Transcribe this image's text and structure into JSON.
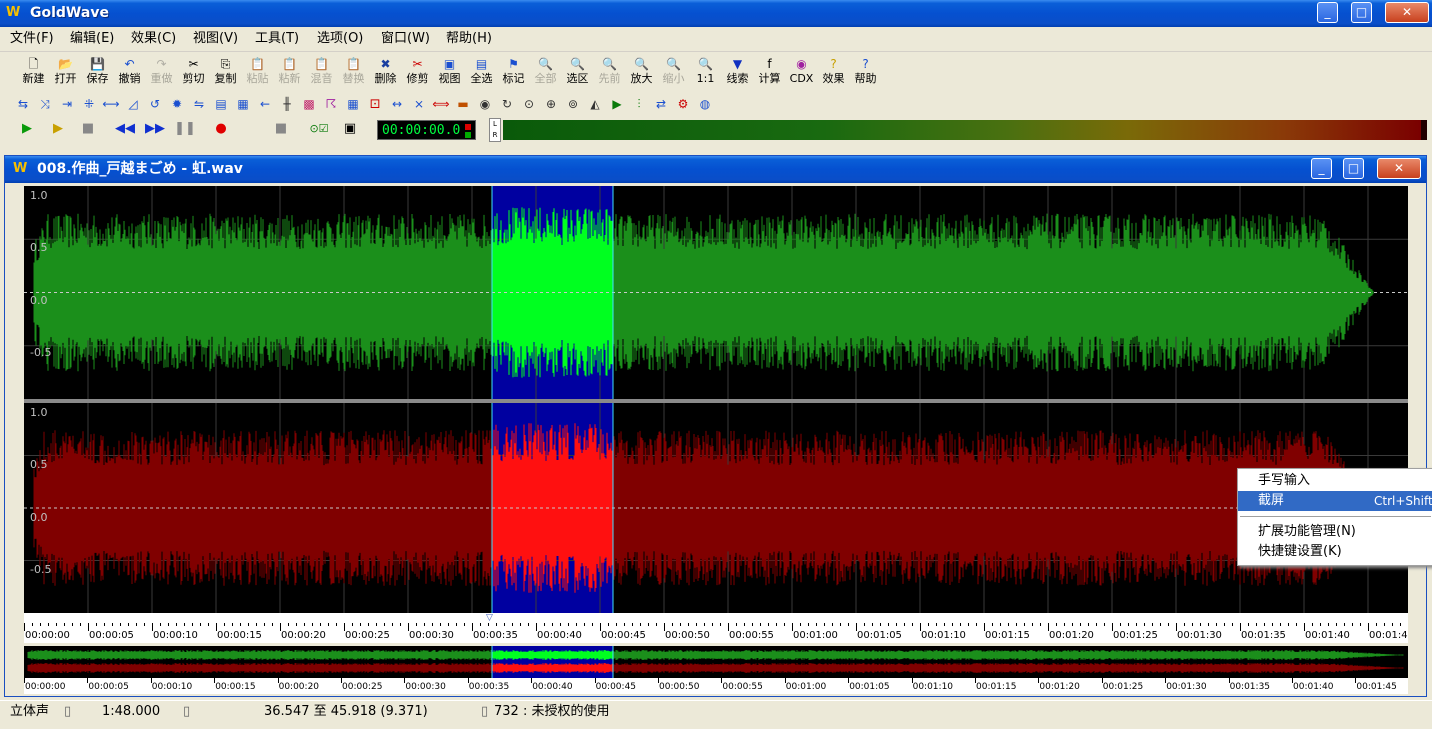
{
  "app": {
    "title": "GoldWave",
    "logo": "W",
    "window_controls": [
      "minimize-icon",
      "maximize-icon",
      "close-icon"
    ]
  },
  "menu": [
    "文件(F)",
    "编辑(E)",
    "效果(C)",
    "视图(V)",
    "工具(T)",
    "选项(O)",
    "窗口(W)",
    "帮助(H)"
  ],
  "toolbar1": [
    {
      "label": "新建",
      "icon": "new-file-icon",
      "enabled": true
    },
    {
      "label": "打开",
      "icon": "open-folder-icon",
      "enabled": true
    },
    {
      "label": "保存",
      "icon": "save-icon",
      "enabled": true
    },
    {
      "label": "撤销",
      "icon": "undo-icon",
      "enabled": true
    },
    {
      "label": "重做",
      "icon": "redo-icon",
      "enabled": false
    },
    {
      "label": "剪切",
      "icon": "cut-icon",
      "enabled": true
    },
    {
      "label": "复制",
      "icon": "copy-icon",
      "enabled": true
    },
    {
      "label": "粘贴",
      "icon": "paste-icon",
      "enabled": false
    },
    {
      "label": "粘新",
      "icon": "paste-new-icon",
      "enabled": false
    },
    {
      "label": "混音",
      "icon": "mix-icon",
      "enabled": false
    },
    {
      "label": "替换",
      "icon": "replace-icon",
      "enabled": false
    },
    {
      "label": "删除",
      "icon": "delete-icon",
      "enabled": true
    },
    {
      "label": "修剪",
      "icon": "trim-icon",
      "enabled": true
    },
    {
      "label": "视图",
      "icon": "view-icon",
      "enabled": true
    },
    {
      "label": "全选",
      "icon": "select-all-icon",
      "enabled": true
    },
    {
      "label": "标记",
      "icon": "marker-icon",
      "enabled": true
    },
    {
      "label": "全部",
      "icon": "zoom-all-icon",
      "enabled": false
    },
    {
      "label": "选区",
      "icon": "zoom-selection-icon",
      "enabled": true
    },
    {
      "label": "先前",
      "icon": "zoom-previous-icon",
      "enabled": false
    },
    {
      "label": "放大",
      "icon": "zoom-in-icon",
      "enabled": true
    },
    {
      "label": "缩小",
      "icon": "zoom-out-icon",
      "enabled": false
    },
    {
      "label": "1:1",
      "icon": "zoom-1-1-icon",
      "enabled": true
    },
    {
      "label": "线索",
      "icon": "cue-icon",
      "enabled": true
    },
    {
      "label": "计算",
      "icon": "calc-icon",
      "enabled": true
    },
    {
      "label": "CDX",
      "icon": "cd-icon",
      "enabled": true
    },
    {
      "label": "效果",
      "icon": "effects-icon",
      "enabled": true
    },
    {
      "label": "帮助",
      "icon": "help-icon",
      "enabled": true
    }
  ],
  "toolbar2_icons": [
    "effect-icon-1",
    "effect-icon-2",
    "effect-icon-3",
    "effect-icon-4",
    "effect-icon-5",
    "effect-icon-6",
    "effect-icon-7",
    "effect-icon-8",
    "effect-icon-9",
    "effect-icon-10",
    "effect-icon-11",
    "effect-icon-12",
    "effect-icon-13",
    "effect-icon-14",
    "effect-icon-15",
    "effect-icon-16",
    "effect-icon-17",
    "effect-icon-18",
    "effect-icon-19",
    "effect-icon-20",
    "effect-icon-21",
    "effect-icon-22",
    "effect-icon-23",
    "effect-icon-24",
    "effect-icon-25",
    "effect-icon-26",
    "effect-icon-27",
    "effect-icon-28",
    "effect-icon-29",
    "effect-icon-30",
    "effect-icon-31",
    "effect-icon-32"
  ],
  "transport": {
    "buttons": [
      "play-icon",
      "play-selection-icon",
      "stop-icon",
      "rewind-icon",
      "fast-forward-icon",
      "pause-icon",
      "record-icon",
      "record-stop-icon",
      "record-mode-icon",
      "record-window-icon"
    ],
    "time": "00:00:00.0",
    "meter_label_l": "L",
    "meter_label_r": "R"
  },
  "document": {
    "title": "008.作曲_戸越まごめ - 虹.wav",
    "left_channel_color": "#1b8f1b",
    "right_channel_color": "#800000",
    "selection_color": "#0000a0",
    "axis_labels": [
      "1.0",
      "0.5",
      "0.0",
      "-0.5"
    ],
    "time_labels": [
      "00:00:00",
      "00:00:05",
      "00:00:10",
      "00:00:15",
      "00:00:20",
      "00:00:25",
      "00:00:30",
      "00:00:35",
      "00:00:40",
      "00:00:45",
      "00:00:50",
      "00:00:55",
      "00:01:00",
      "00:01:05",
      "00:01:10",
      "00:01:15",
      "00:01:20",
      "00:01:25",
      "00:01:30",
      "00:01:35",
      "00:01:40",
      "00:01:4"
    ],
    "overview_time_labels": [
      "00:00:00",
      "00:00:05",
      "00:00:10",
      "00:00:15",
      "00:00:20",
      "00:00:25",
      "00:00:30",
      "00:00:35",
      "00:00:40",
      "00:00:45",
      "00:00:50",
      "00:00:55",
      "00:01:00",
      "00:01:05",
      "00:01:10",
      "00:01:15",
      "00:01:20",
      "00:01:25",
      "00:01:30",
      "00:01:35",
      "00:01:40",
      "00:01:45"
    ]
  },
  "status": {
    "channels": "立体声",
    "length": "1:48.000",
    "selection": "36.547 至 45.918 (9.371)",
    "message": "732 : 未授权的使用"
  },
  "context_menu": [
    {
      "label": "手写输入",
      "shortcut": "",
      "selected": false
    },
    {
      "label": "截屏",
      "shortcut": "Ctrl+Shift+",
      "selected": true
    },
    {
      "label": "扩展功能管理(N)",
      "shortcut": "",
      "selected": false
    },
    {
      "label": "快捷键设置(K)",
      "shortcut": "",
      "selected": false
    }
  ]
}
